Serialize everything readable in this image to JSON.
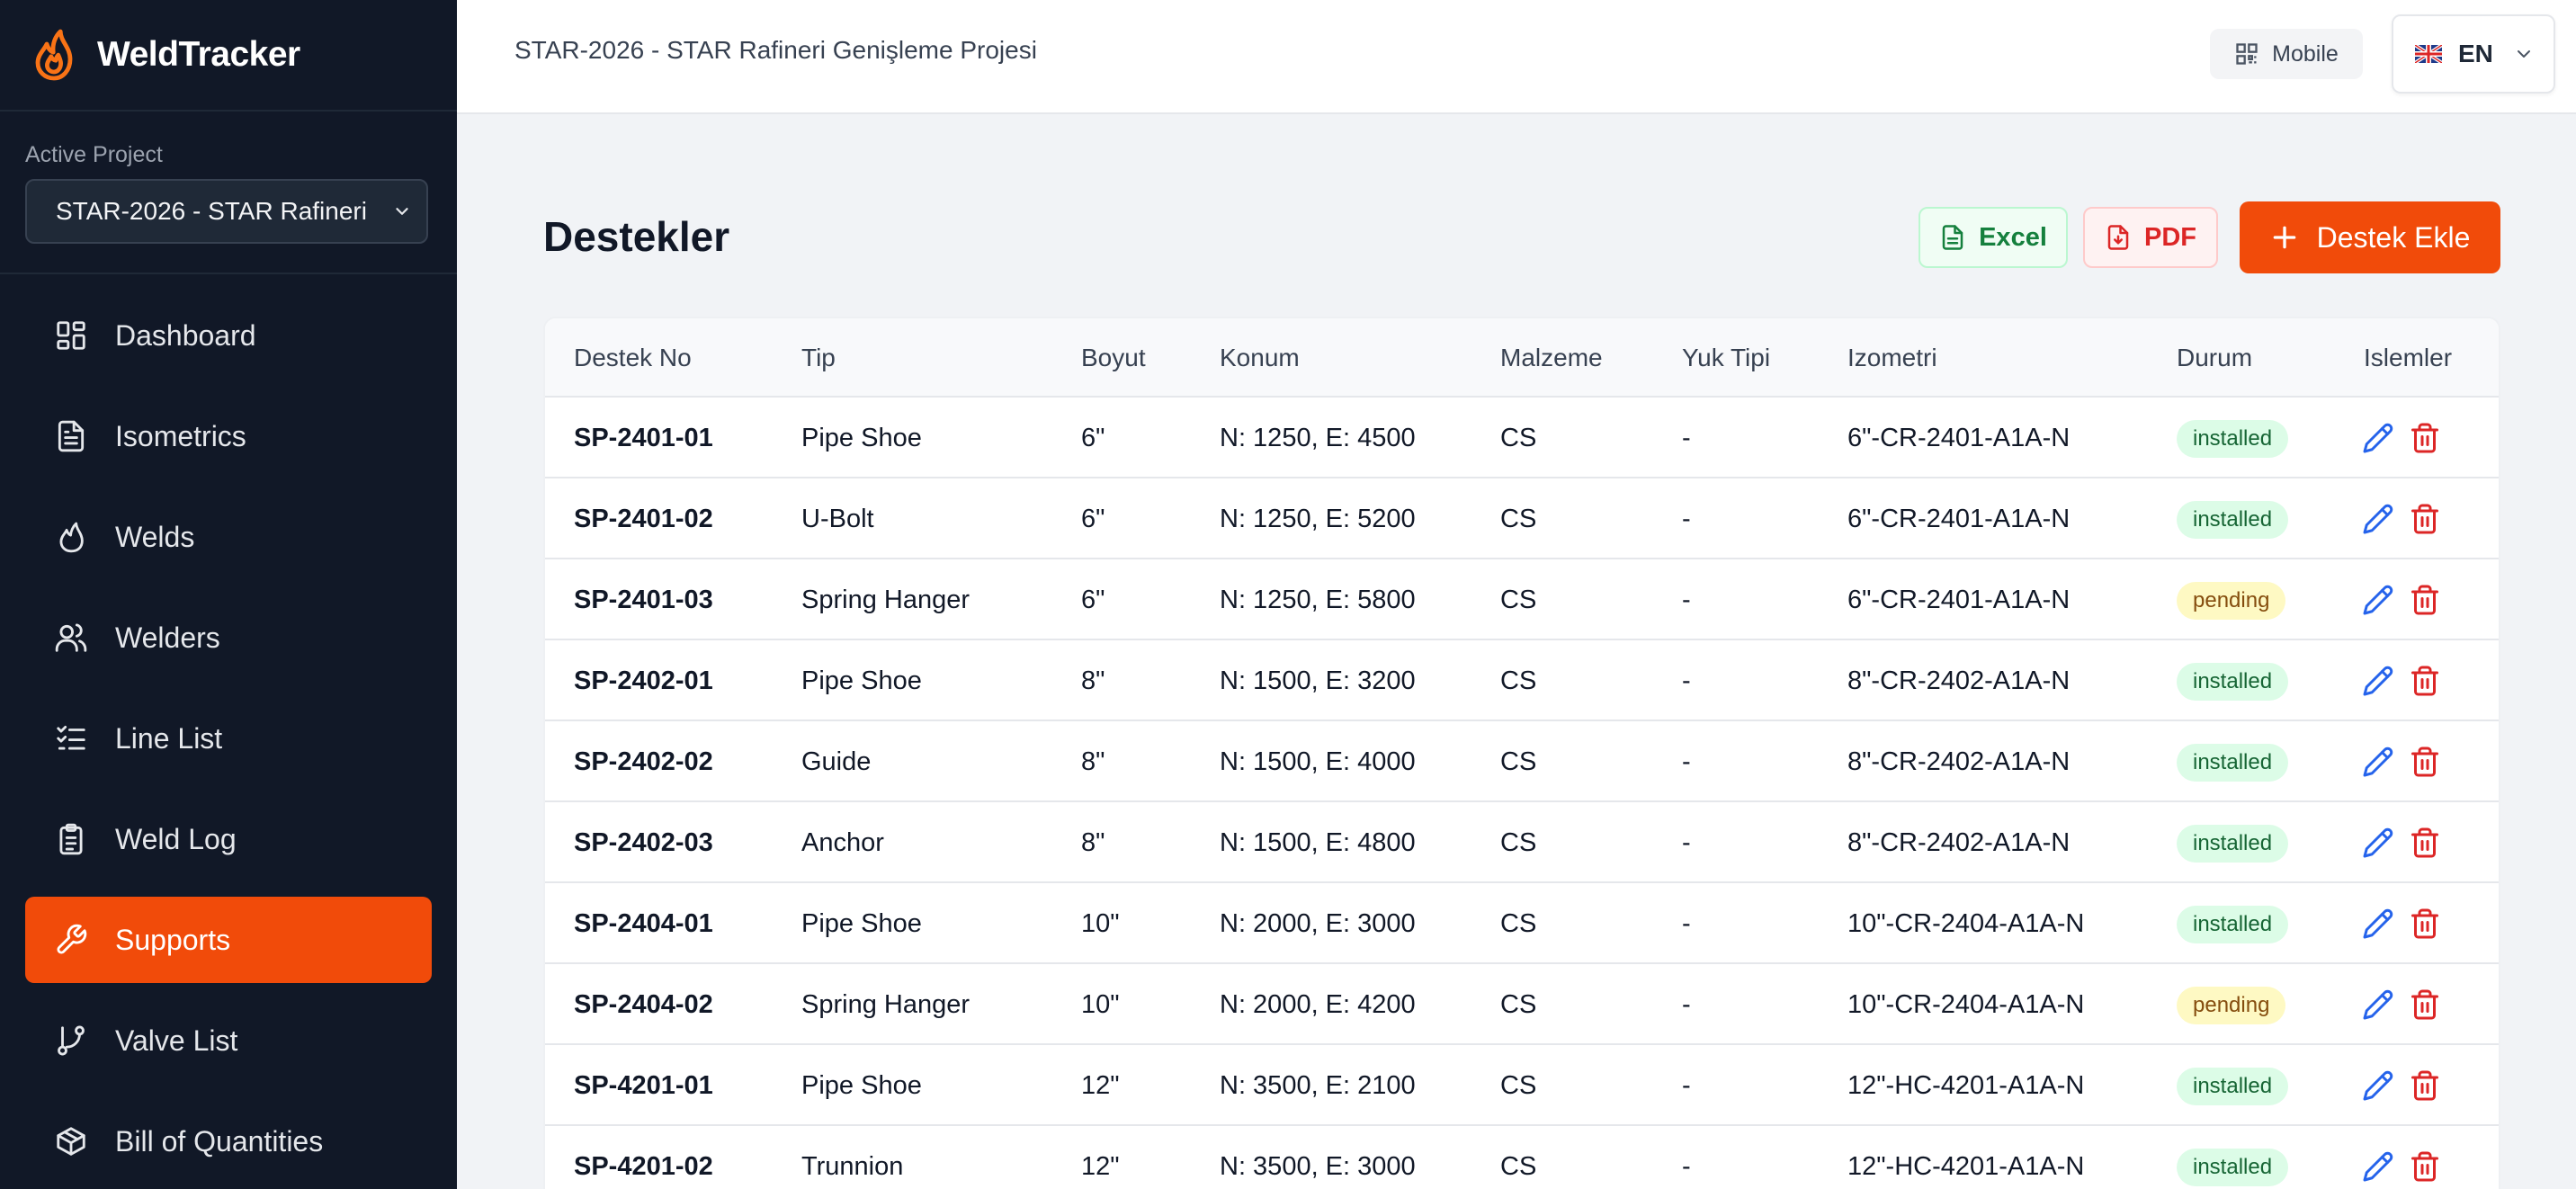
{
  "app": {
    "name": "WeldTracker"
  },
  "sidebar": {
    "project_label": "Active Project",
    "project_value": "STAR-2026 - STAR Rafineri",
    "items": [
      {
        "label": "Dashboard",
        "icon": "dashboard-icon"
      },
      {
        "label": "Isometrics",
        "icon": "document-icon"
      },
      {
        "label": "Welds",
        "icon": "flame-icon"
      },
      {
        "label": "Welders",
        "icon": "users-icon"
      },
      {
        "label": "Line List",
        "icon": "list-check-icon"
      },
      {
        "label": "Weld Log",
        "icon": "clipboard-icon"
      },
      {
        "label": "Supports",
        "icon": "wrench-icon",
        "active": true
      },
      {
        "label": "Valve List",
        "icon": "git-branch-icon"
      },
      {
        "label": "Bill of Quantities",
        "icon": "package-icon"
      }
    ]
  },
  "header": {
    "project_title": "STAR-2026 - STAR Rafineri Genişleme Projesi",
    "mobile_label": "Mobile",
    "language": "EN"
  },
  "main": {
    "title": "Destekler",
    "excel_label": "Excel",
    "pdf_label": "PDF",
    "add_label": "Destek Ekle"
  },
  "table": {
    "columns": [
      "Destek No",
      "Tip",
      "Boyut",
      "Konum",
      "Malzeme",
      "Yuk Tipi",
      "Izometri",
      "Durum",
      "Islemler"
    ],
    "rows": [
      {
        "no": "SP-2401-01",
        "tip": "Pipe Shoe",
        "boyut": "6\"",
        "konum": "N: 1250, E: 4500",
        "malzeme": "CS",
        "yuk": "-",
        "izometri": "6\"-CR-2401-A1A-N",
        "durum": "installed"
      },
      {
        "no": "SP-2401-02",
        "tip": "U-Bolt",
        "boyut": "6\"",
        "konum": "N: 1250, E: 5200",
        "malzeme": "CS",
        "yuk": "-",
        "izometri": "6\"-CR-2401-A1A-N",
        "durum": "installed"
      },
      {
        "no": "SP-2401-03",
        "tip": "Spring Hanger",
        "boyut": "6\"",
        "konum": "N: 1250, E: 5800",
        "malzeme": "CS",
        "yuk": "-",
        "izometri": "6\"-CR-2401-A1A-N",
        "durum": "pending"
      },
      {
        "no": "SP-2402-01",
        "tip": "Pipe Shoe",
        "boyut": "8\"",
        "konum": "N: 1500, E: 3200",
        "malzeme": "CS",
        "yuk": "-",
        "izometri": "8\"-CR-2402-A1A-N",
        "durum": "installed"
      },
      {
        "no": "SP-2402-02",
        "tip": "Guide",
        "boyut": "8\"",
        "konum": "N: 1500, E: 4000",
        "malzeme": "CS",
        "yuk": "-",
        "izometri": "8\"-CR-2402-A1A-N",
        "durum": "installed"
      },
      {
        "no": "SP-2402-03",
        "tip": "Anchor",
        "boyut": "8\"",
        "konum": "N: 1500, E: 4800",
        "malzeme": "CS",
        "yuk": "-",
        "izometri": "8\"-CR-2402-A1A-N",
        "durum": "installed"
      },
      {
        "no": "SP-2404-01",
        "tip": "Pipe Shoe",
        "boyut": "10\"",
        "konum": "N: 2000, E: 3000",
        "malzeme": "CS",
        "yuk": "-",
        "izometri": "10\"-CR-2404-A1A-N",
        "durum": "installed"
      },
      {
        "no": "SP-2404-02",
        "tip": "Spring Hanger",
        "boyut": "10\"",
        "konum": "N: 2000, E: 4200",
        "malzeme": "CS",
        "yuk": "-",
        "izometri": "10\"-CR-2404-A1A-N",
        "durum": "pending"
      },
      {
        "no": "SP-4201-01",
        "tip": "Pipe Shoe",
        "boyut": "12\"",
        "konum": "N: 3500, E: 2100",
        "malzeme": "CS",
        "yuk": "-",
        "izometri": "12\"-HC-4201-A1A-N",
        "durum": "installed"
      },
      {
        "no": "SP-4201-02",
        "tip": "Trunnion",
        "boyut": "12\"",
        "konum": "N: 3500, E: 3000",
        "malzeme": "CS",
        "yuk": "-",
        "izometri": "12\"-HC-4201-A1A-N",
        "durum": "installed"
      }
    ]
  },
  "colors": {
    "accent": "#f14b0a",
    "sidebar_bg": "#111827",
    "edit_icon": "#2563eb",
    "delete_icon": "#dc2626"
  }
}
